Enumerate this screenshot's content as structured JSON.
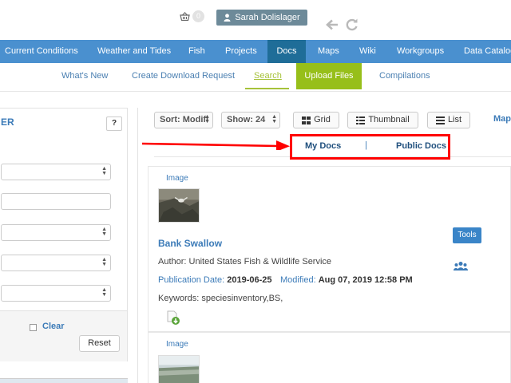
{
  "topbar": {
    "cart_icon": "basket-icon",
    "cart_count": "0",
    "user_name": "Sarah Dolislager",
    "user_icon": "user-icon",
    "back_icon": "back-arrow-icon",
    "refresh_icon": "refresh-icon"
  },
  "mainnav": {
    "items": [
      "Current Conditions",
      "Weather and Tides",
      "Fish",
      "Projects",
      "Docs",
      "Maps",
      "Wiki",
      "Workgroups",
      "Data Catalog"
    ],
    "active": "Docs"
  },
  "subnav": {
    "items": [
      "What's New",
      "Create Download Request",
      "Search",
      "Upload Files",
      "Compilations"
    ],
    "active": "Search"
  },
  "leftpanel": {
    "title_fragment": "ER",
    "help_label": "?",
    "clear_label": "Clear",
    "reset_label": "Reset"
  },
  "toolbar": {
    "sort_label": "Sort: Modifi",
    "show_label": "Show: 24",
    "grid_label": "Grid",
    "thumbnail_label": "Thumbnail",
    "list_label": "List",
    "map_label": "Map"
  },
  "tabs": {
    "my_docs": "My Docs",
    "separator": "|",
    "public_docs": "Public Docs"
  },
  "results": [
    {
      "type": "Image",
      "title": "Bank Swallow",
      "author": "Author: United States Fish & Wildlife Service",
      "publication_label": "Publication Date:",
      "publication_date": "2019-06-25",
      "modified_label": "Modified:",
      "modified_date": "Aug 07, 2019 12:58 PM",
      "keywords": "Keywords: speciesinventory,BS,",
      "tools_label": "Tools"
    },
    {
      "type": "Image"
    }
  ],
  "colors": {
    "nav_blue": "#4a90cf",
    "nav_active": "#1f6d98",
    "upload_green": "#97bf1a",
    "search_green": "#a6c23a",
    "link_blue": "#3c7bb8",
    "annotation_red": "#ff0000"
  }
}
